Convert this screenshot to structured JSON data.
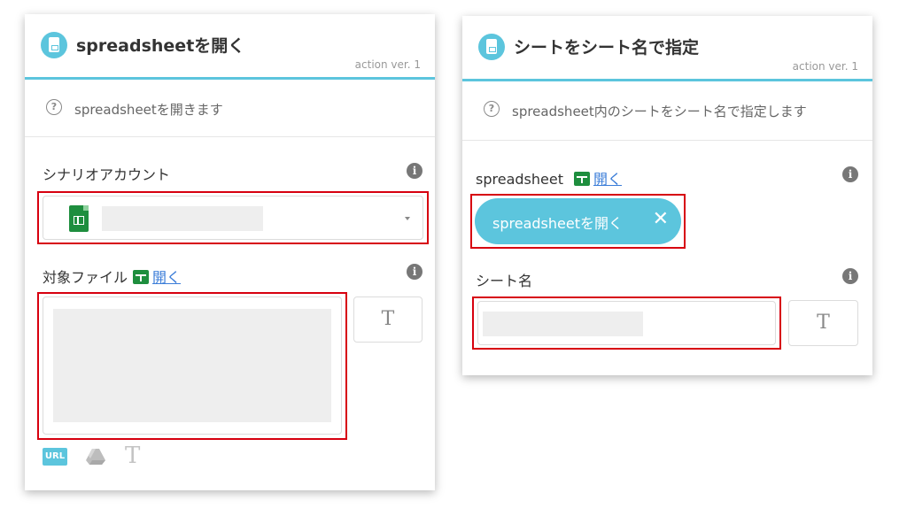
{
  "left_panel": {
    "title": "spreadsheetを開く",
    "version": "action ver. 1",
    "description": "spreadsheetを開きます",
    "help_glyph": "?",
    "scenario_account": {
      "label": "シナリオアカウント",
      "info_glyph": "i",
      "icon": "google-sheets-icon"
    },
    "target_file": {
      "label": "対象ファイル",
      "open_link": "開く",
      "info_glyph": "i"
    },
    "text_toggle_label": "T",
    "bottom_icons": {
      "url_label": "URL",
      "drive_icon": "google-drive-icon",
      "text_label": "T"
    }
  },
  "right_panel": {
    "title": "シートをシート名で指定",
    "version": "action ver. 1",
    "description": "spreadsheet内のシートをシート名で指定します",
    "help_glyph": "?",
    "spreadsheet": {
      "label": "spreadsheet",
      "open_link": "開く",
      "info_glyph": "i",
      "pill_label": "spreadsheetを開く",
      "pill_close": "✕"
    },
    "sheet_name": {
      "label": "シート名",
      "info_glyph": "i"
    },
    "text_toggle_label": "T"
  },
  "colors": {
    "accent": "#5cc5dd",
    "highlight": "#d7000f",
    "sheets_green": "#1e8e3e",
    "link": "#3b7dd8"
  }
}
